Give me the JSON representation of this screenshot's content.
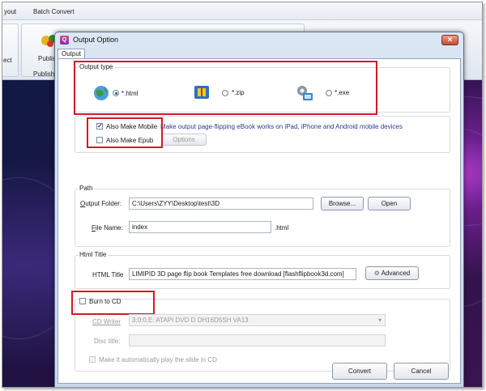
{
  "background_app": {
    "menu": [
      "yout",
      "Batch Convert"
    ],
    "ribbon_labels": [
      "ect",
      "Publis",
      "Publish"
    ]
  },
  "dialog": {
    "title": "Output Option",
    "tab": "Output",
    "output_type": {
      "title": "Output type",
      "options": [
        {
          "label": "*.html",
          "selected": true,
          "icon": "globe-icon"
        },
        {
          "label": "*.zip",
          "selected": false,
          "icon": "zip-archive-icon"
        },
        {
          "label": "*.exe",
          "selected": false,
          "icon": "gear-computer-icon"
        }
      ]
    },
    "mobile": {
      "also_make_mobile": "Also Make Mobile",
      "also_make_mobile_checked": true,
      "mobile_note": "Make output page-flipping eBook works on iPad, iPhone and Android mobile devices",
      "also_make_epub": "Also Make Epub",
      "also_make_epub_checked": false,
      "options_button": "Options"
    },
    "path": {
      "title": "Path",
      "output_folder_label": "Output Folder:",
      "output_folder_value": "C:\\Users\\ZYY\\Desktop\\test\\3D",
      "browse_button": "Browse...",
      "open_button": "Open",
      "file_name_label": "File Name:",
      "file_name_value": "index",
      "file_ext": ".html"
    },
    "html_title": {
      "title": "Html Title",
      "label": "HTML Title",
      "value": "LIMIPID 3D page flip book Templates free download [flashflipbook3d.com]",
      "advanced_button": "Advanced"
    },
    "burn": {
      "burn_label": "Burn to CD",
      "burn_checked": false,
      "cd_writer_label": "CD Writer",
      "cd_writer_value": "3:0:0,E: ATAPI   DVD D  DH16D5SH  VA13",
      "disc_title_label": "Disc title:",
      "disc_title_value": "",
      "autoplay_label": "Make it automatically play the  slide in CD",
      "autoplay_checked": false
    },
    "convert_button": "Convert",
    "cancel_button": "Cancel"
  },
  "colors": {
    "highlight_box": "#d21a26",
    "dialog_frame": "#c8d8ec"
  }
}
